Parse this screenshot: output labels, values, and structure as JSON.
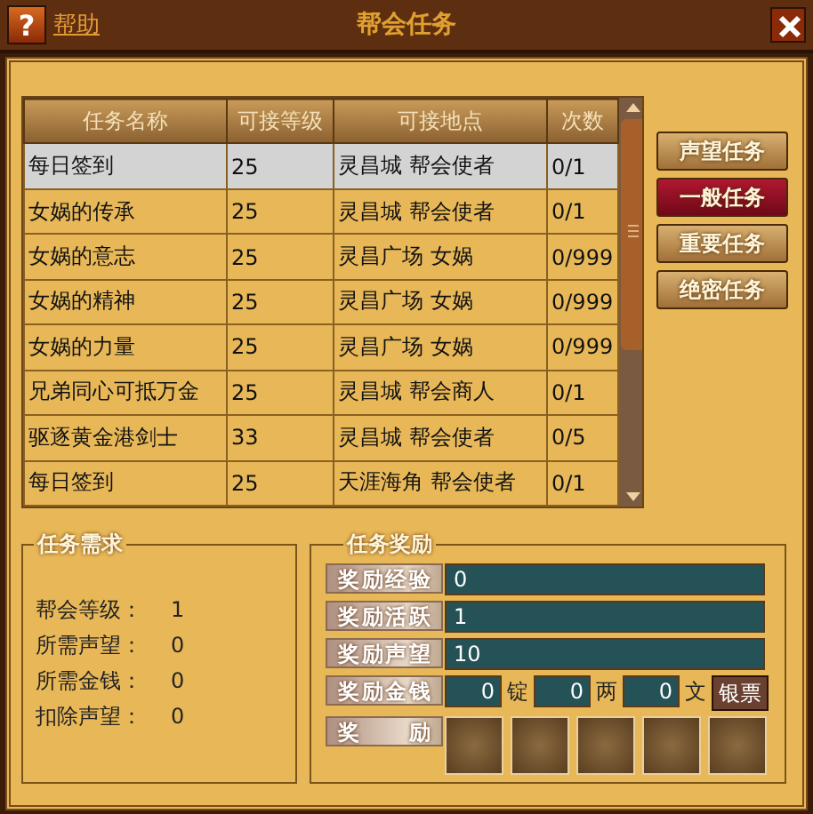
{
  "window": {
    "title": "帮会任务",
    "help_icon": "?",
    "help_link": "帮助"
  },
  "task_table": {
    "columns": [
      "任务名称",
      "可接等级",
      "可接地点",
      "次数"
    ],
    "rows": [
      {
        "name": "每日签到",
        "level": "25",
        "place": "灵昌城 帮会使者",
        "count": "0/1",
        "selected": true
      },
      {
        "name": "女娲的传承",
        "level": "25",
        "place": "灵昌城 帮会使者",
        "count": "0/1",
        "selected": false
      },
      {
        "name": "女娲的意志",
        "level": "25",
        "place": "灵昌广场 女娲",
        "count": "0/999",
        "selected": false
      },
      {
        "name": "女娲的精神",
        "level": "25",
        "place": "灵昌广场 女娲",
        "count": "0/999",
        "selected": false
      },
      {
        "name": "女娲的力量",
        "level": "25",
        "place": "灵昌广场 女娲",
        "count": "0/999",
        "selected": false
      },
      {
        "name": "兄弟同心可抵万金",
        "level": "25",
        "place": "灵昌城 帮会商人",
        "count": "0/1",
        "selected": false
      },
      {
        "name": "驱逐黄金港剑士",
        "level": "33",
        "place": "灵昌城 帮会使者",
        "count": "0/5",
        "selected": false
      },
      {
        "name": "每日签到",
        "level": "25",
        "place": "天涯海角 帮会使者",
        "count": "0/1",
        "selected": false
      }
    ]
  },
  "category_buttons": [
    {
      "label": "声望任务",
      "selected": false
    },
    {
      "label": "一般任务",
      "selected": true
    },
    {
      "label": "重要任务",
      "selected": false
    },
    {
      "label": "绝密任务",
      "selected": false
    }
  ],
  "requirements": {
    "title": "任务需求",
    "items": [
      {
        "label": "帮会等级：",
        "value": "1"
      },
      {
        "label": "所需声望：",
        "value": "0"
      },
      {
        "label": "所需金钱：",
        "value": "0"
      },
      {
        "label": "扣除声望：",
        "value": "0"
      }
    ]
  },
  "rewards": {
    "title": "任务奖励",
    "rows": [
      {
        "kind": "value",
        "label": "奖励经验",
        "value": "0"
      },
      {
        "kind": "value",
        "label": "奖励活跃",
        "value": "1"
      },
      {
        "kind": "value",
        "label": "奖励声望",
        "value": "10"
      },
      {
        "kind": "money",
        "label": "奖励金钱",
        "amounts": [
          {
            "value": "0",
            "unit": "锭"
          },
          {
            "value": "0",
            "unit": "两"
          },
          {
            "value": "0",
            "unit": "文"
          }
        ],
        "button": "银票"
      },
      {
        "kind": "slots",
        "label": "奖 励",
        "slots": [
          {
            "filled": false
          },
          {
            "filled": false
          },
          {
            "filled": false
          },
          {
            "filled": false
          },
          {
            "filled": false
          }
        ]
      }
    ]
  }
}
